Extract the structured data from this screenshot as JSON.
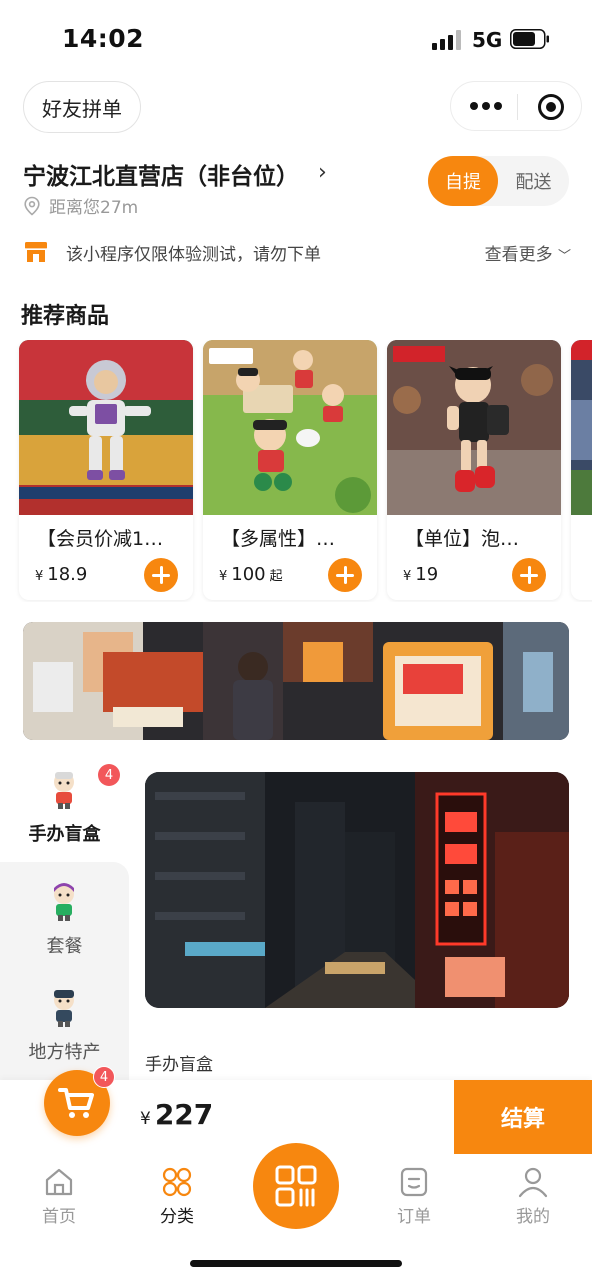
{
  "status_bar": {
    "time": "14:02",
    "network": "5G"
  },
  "header": {
    "group_order_label": "好友拼单"
  },
  "store": {
    "name": "宁波江北直营店（非台位）",
    "distance": "距离您27m",
    "modes": {
      "active": "自提",
      "inactive": "配送"
    }
  },
  "notice": {
    "text": "该小程序仅限体验测试，请勿下单",
    "more": "查看更多"
  },
  "recommend": {
    "title": "推荐商品",
    "products": [
      {
        "name": "【会员价减1…",
        "currency": "¥",
        "price": "18.9",
        "price_suffix": ""
      },
      {
        "name": "【多属性】…",
        "currency": "¥",
        "price": "100",
        "price_suffix": "起"
      },
      {
        "name": "【单位】泡…",
        "currency": "¥",
        "price": "19",
        "price_suffix": ""
      }
    ]
  },
  "categories": {
    "items": [
      {
        "label": "手办盲盒",
        "badge": "4",
        "active": true
      },
      {
        "label": "套餐",
        "active": false
      },
      {
        "label": "地方特产",
        "active": false
      }
    ],
    "current_heading": "手办盲盒"
  },
  "cart": {
    "badge": "4",
    "currency": "¥",
    "total": "227",
    "checkout_label": "结算"
  },
  "tabs": [
    {
      "label": "首页",
      "icon": "home-icon",
      "active": false
    },
    {
      "label": "分类",
      "icon": "category-icon",
      "active": true
    },
    {
      "label": "订单",
      "icon": "order-icon",
      "active": false
    },
    {
      "label": "我的",
      "icon": "profile-icon",
      "active": false
    }
  ],
  "colors": {
    "accent": "#f7870f",
    "badge": "#f2575a",
    "muted": "#999999"
  }
}
